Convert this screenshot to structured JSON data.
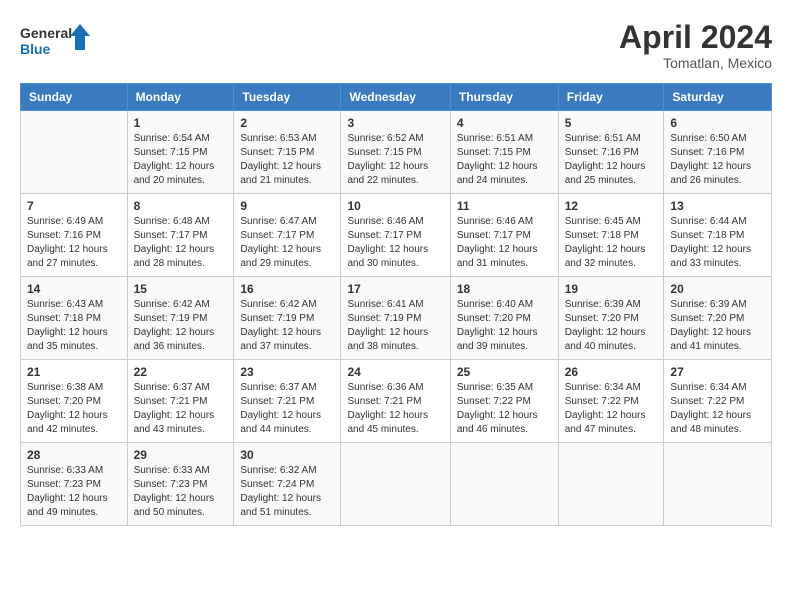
{
  "logo": {
    "line1": "General",
    "line2": "Blue"
  },
  "title": "April 2024",
  "subtitle": "Tomatlan, Mexico",
  "header_days": [
    "Sunday",
    "Monday",
    "Tuesday",
    "Wednesday",
    "Thursday",
    "Friday",
    "Saturday"
  ],
  "weeks": [
    [
      {
        "num": "",
        "info": ""
      },
      {
        "num": "1",
        "info": "Sunrise: 6:54 AM\nSunset: 7:15 PM\nDaylight: 12 hours\nand 20 minutes."
      },
      {
        "num": "2",
        "info": "Sunrise: 6:53 AM\nSunset: 7:15 PM\nDaylight: 12 hours\nand 21 minutes."
      },
      {
        "num": "3",
        "info": "Sunrise: 6:52 AM\nSunset: 7:15 PM\nDaylight: 12 hours\nand 22 minutes."
      },
      {
        "num": "4",
        "info": "Sunrise: 6:51 AM\nSunset: 7:15 PM\nDaylight: 12 hours\nand 24 minutes."
      },
      {
        "num": "5",
        "info": "Sunrise: 6:51 AM\nSunset: 7:16 PM\nDaylight: 12 hours\nand 25 minutes."
      },
      {
        "num": "6",
        "info": "Sunrise: 6:50 AM\nSunset: 7:16 PM\nDaylight: 12 hours\nand 26 minutes."
      }
    ],
    [
      {
        "num": "7",
        "info": "Sunrise: 6:49 AM\nSunset: 7:16 PM\nDaylight: 12 hours\nand 27 minutes."
      },
      {
        "num": "8",
        "info": "Sunrise: 6:48 AM\nSunset: 7:17 PM\nDaylight: 12 hours\nand 28 minutes."
      },
      {
        "num": "9",
        "info": "Sunrise: 6:47 AM\nSunset: 7:17 PM\nDaylight: 12 hours\nand 29 minutes."
      },
      {
        "num": "10",
        "info": "Sunrise: 6:46 AM\nSunset: 7:17 PM\nDaylight: 12 hours\nand 30 minutes."
      },
      {
        "num": "11",
        "info": "Sunrise: 6:46 AM\nSunset: 7:17 PM\nDaylight: 12 hours\nand 31 minutes."
      },
      {
        "num": "12",
        "info": "Sunrise: 6:45 AM\nSunset: 7:18 PM\nDaylight: 12 hours\nand 32 minutes."
      },
      {
        "num": "13",
        "info": "Sunrise: 6:44 AM\nSunset: 7:18 PM\nDaylight: 12 hours\nand 33 minutes."
      }
    ],
    [
      {
        "num": "14",
        "info": "Sunrise: 6:43 AM\nSunset: 7:18 PM\nDaylight: 12 hours\nand 35 minutes."
      },
      {
        "num": "15",
        "info": "Sunrise: 6:42 AM\nSunset: 7:19 PM\nDaylight: 12 hours\nand 36 minutes."
      },
      {
        "num": "16",
        "info": "Sunrise: 6:42 AM\nSunset: 7:19 PM\nDaylight: 12 hours\nand 37 minutes."
      },
      {
        "num": "17",
        "info": "Sunrise: 6:41 AM\nSunset: 7:19 PM\nDaylight: 12 hours\nand 38 minutes."
      },
      {
        "num": "18",
        "info": "Sunrise: 6:40 AM\nSunset: 7:20 PM\nDaylight: 12 hours\nand 39 minutes."
      },
      {
        "num": "19",
        "info": "Sunrise: 6:39 AM\nSunset: 7:20 PM\nDaylight: 12 hours\nand 40 minutes."
      },
      {
        "num": "20",
        "info": "Sunrise: 6:39 AM\nSunset: 7:20 PM\nDaylight: 12 hours\nand 41 minutes."
      }
    ],
    [
      {
        "num": "21",
        "info": "Sunrise: 6:38 AM\nSunset: 7:20 PM\nDaylight: 12 hours\nand 42 minutes."
      },
      {
        "num": "22",
        "info": "Sunrise: 6:37 AM\nSunset: 7:21 PM\nDaylight: 12 hours\nand 43 minutes."
      },
      {
        "num": "23",
        "info": "Sunrise: 6:37 AM\nSunset: 7:21 PM\nDaylight: 12 hours\nand 44 minutes."
      },
      {
        "num": "24",
        "info": "Sunrise: 6:36 AM\nSunset: 7:21 PM\nDaylight: 12 hours\nand 45 minutes."
      },
      {
        "num": "25",
        "info": "Sunrise: 6:35 AM\nSunset: 7:22 PM\nDaylight: 12 hours\nand 46 minutes."
      },
      {
        "num": "26",
        "info": "Sunrise: 6:34 AM\nSunset: 7:22 PM\nDaylight: 12 hours\nand 47 minutes."
      },
      {
        "num": "27",
        "info": "Sunrise: 6:34 AM\nSunset: 7:22 PM\nDaylight: 12 hours\nand 48 minutes."
      }
    ],
    [
      {
        "num": "28",
        "info": "Sunrise: 6:33 AM\nSunset: 7:23 PM\nDaylight: 12 hours\nand 49 minutes."
      },
      {
        "num": "29",
        "info": "Sunrise: 6:33 AM\nSunset: 7:23 PM\nDaylight: 12 hours\nand 50 minutes."
      },
      {
        "num": "30",
        "info": "Sunrise: 6:32 AM\nSunset: 7:24 PM\nDaylight: 12 hours\nand 51 minutes."
      },
      {
        "num": "",
        "info": ""
      },
      {
        "num": "",
        "info": ""
      },
      {
        "num": "",
        "info": ""
      },
      {
        "num": "",
        "info": ""
      }
    ]
  ],
  "accent_color": "#3a7abf"
}
